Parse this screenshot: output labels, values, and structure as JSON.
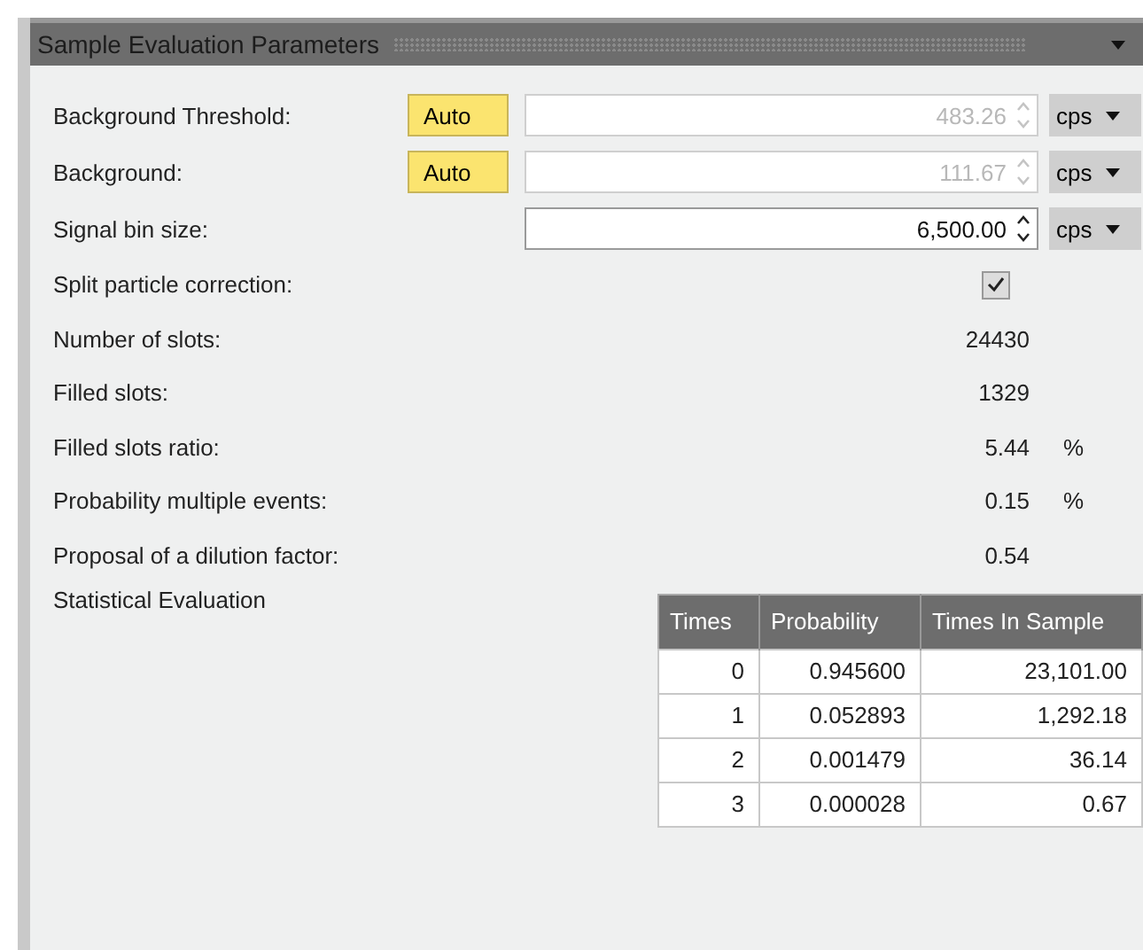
{
  "panel": {
    "title": "Sample Evaluation Parameters",
    "expanded": true
  },
  "rows": [
    {
      "kind": "auto_field",
      "label": "Background Threshold:",
      "button": "Auto",
      "value": "483.26",
      "disabled": true,
      "unit": "cps"
    },
    {
      "kind": "auto_field",
      "label": "Background:",
      "button": "Auto",
      "value": "111.67",
      "disabled": true,
      "unit": "cps"
    },
    {
      "kind": "field",
      "label": "Signal bin size:",
      "value": "6,500.00",
      "disabled": false,
      "unit": "cps"
    },
    {
      "kind": "checkbox",
      "label": "Split particle correction:",
      "checked": true
    },
    {
      "kind": "readout",
      "label": "Number of slots:",
      "value": "24430"
    },
    {
      "kind": "readout",
      "label": "Filled slots:",
      "value": "1329"
    },
    {
      "kind": "readout",
      "label": "Filled slots ratio:",
      "value": "5.44",
      "unit": "%"
    },
    {
      "kind": "readout",
      "label": "Probability multiple events:",
      "value": "0.15",
      "unit": "%"
    },
    {
      "kind": "readout",
      "label": "Proposal of a dilution factor:",
      "value": "0.54"
    }
  ],
  "statistical_evaluation": {
    "label": "Statistical Evaluation",
    "table": {
      "columns": [
        "Times",
        "Probability",
        "Times In Sample"
      ],
      "rows": [
        [
          "0",
          "0.945600",
          "23,101.00"
        ],
        [
          "1",
          "0.052893",
          "1,292.18"
        ],
        [
          "2",
          "0.001479",
          "36.14"
        ],
        [
          "3",
          "0.000028",
          "0.67"
        ]
      ]
    }
  }
}
